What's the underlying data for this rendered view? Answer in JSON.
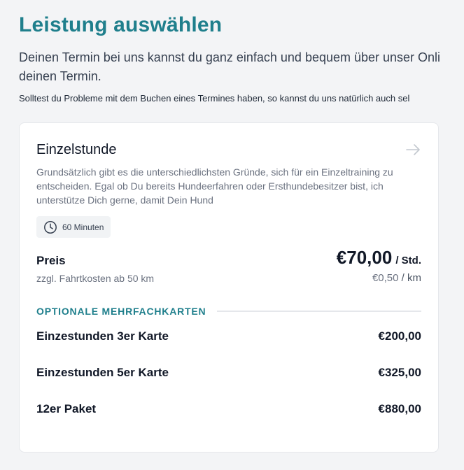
{
  "header": {
    "title": "Leistung auswählen",
    "lead_line1": "Deinen Termin bei uns kannst du ganz einfach und bequem über unser Onli",
    "lead_line2": "deinen Termin.",
    "note": "Solltest du Probleme mit dem Buchen eines Termines haben, so kannst du uns natürlich auch sel"
  },
  "service": {
    "title": "Einzelstunde",
    "description_lines": [
      "Grundsätzlich gibt es die unterschiedlichsten Gründe, sich für ein Einzeltraining zu",
      "entscheiden. Egal ob Du bereits Hundeerfahren oder Ersthundebesitzer bist, ich",
      "unterstütze Dich gerne, damit Dein Hund"
    ],
    "duration": "60 Minuten",
    "duration_icon": "clock-icon",
    "arrow_icon": "arrow-right-icon",
    "price_label": "Preis",
    "price_amount": "€70,00",
    "price_unit": "/ Std.",
    "travel_note": "zzgl. Fahrtkosten ab 50 km",
    "travel_price": "€0,50",
    "travel_unit": "/ km"
  },
  "optional": {
    "heading": "OPTIONALE MEHRFACHKARTEN",
    "packages": [
      {
        "name": "Einzestunden 3er Karte",
        "price": "€200,00"
      },
      {
        "name": "Einzestunden 5er Karte",
        "price": "€325,00"
      },
      {
        "name": "12er Paket",
        "price": "€880,00"
      }
    ]
  },
  "colors": {
    "accent": "#1f7f8c",
    "background": "#f3f4f6",
    "card": "#ffffff",
    "muted_text": "#6b7280"
  }
}
